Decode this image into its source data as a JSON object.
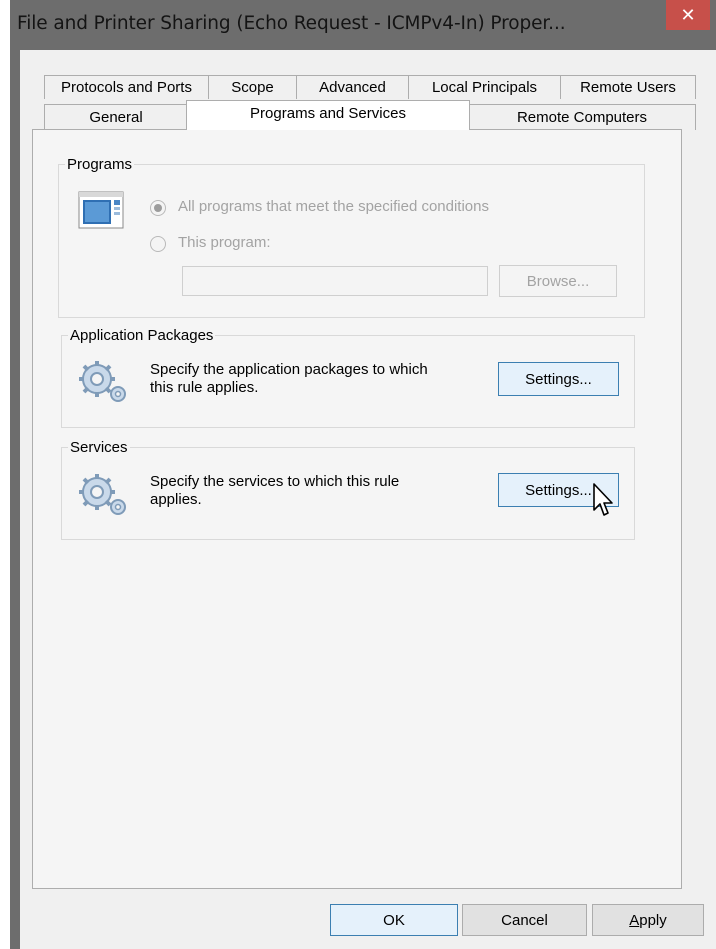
{
  "window": {
    "title": "File and Printer Sharing (Echo Request - ICMPv4-In) Proper...",
    "close_glyph": "✕",
    "title_bar_color": "#6d6d6d",
    "close_color": "#c7504a"
  },
  "tabs": {
    "row1": [
      "Protocols and Ports",
      "Scope",
      "Advanced",
      "Local Principals",
      "Remote Users"
    ],
    "row2": [
      "General",
      "Programs and Services",
      "Remote Computers"
    ],
    "active": "Programs and Services"
  },
  "programs": {
    "legend": "Programs",
    "icon": "program-window-icon",
    "option_all": "All programs that meet the specified conditions",
    "option_this": "This program:",
    "program_path": "",
    "browse_label": "Browse..."
  },
  "app_packages": {
    "legend": "Application Packages",
    "icon": "gears-icon",
    "description_line1": "Specify the application packages to which",
    "description_line2": "this rule applies.",
    "settings_label": "Settings..."
  },
  "services": {
    "legend": "Services",
    "icon": "gears-icon",
    "description_line1": "Specify the services to which this rule",
    "description_line2": "applies.",
    "settings_label": "Settings..."
  },
  "footer": {
    "ok_label": "OK",
    "cancel_label": "Cancel",
    "apply_label": "Apply",
    "apply_access_key": "A",
    "apply_rest": "pply"
  },
  "colors": {
    "accent_border": "#3c7fb1",
    "accent_fill": "#e5f1fb"
  }
}
